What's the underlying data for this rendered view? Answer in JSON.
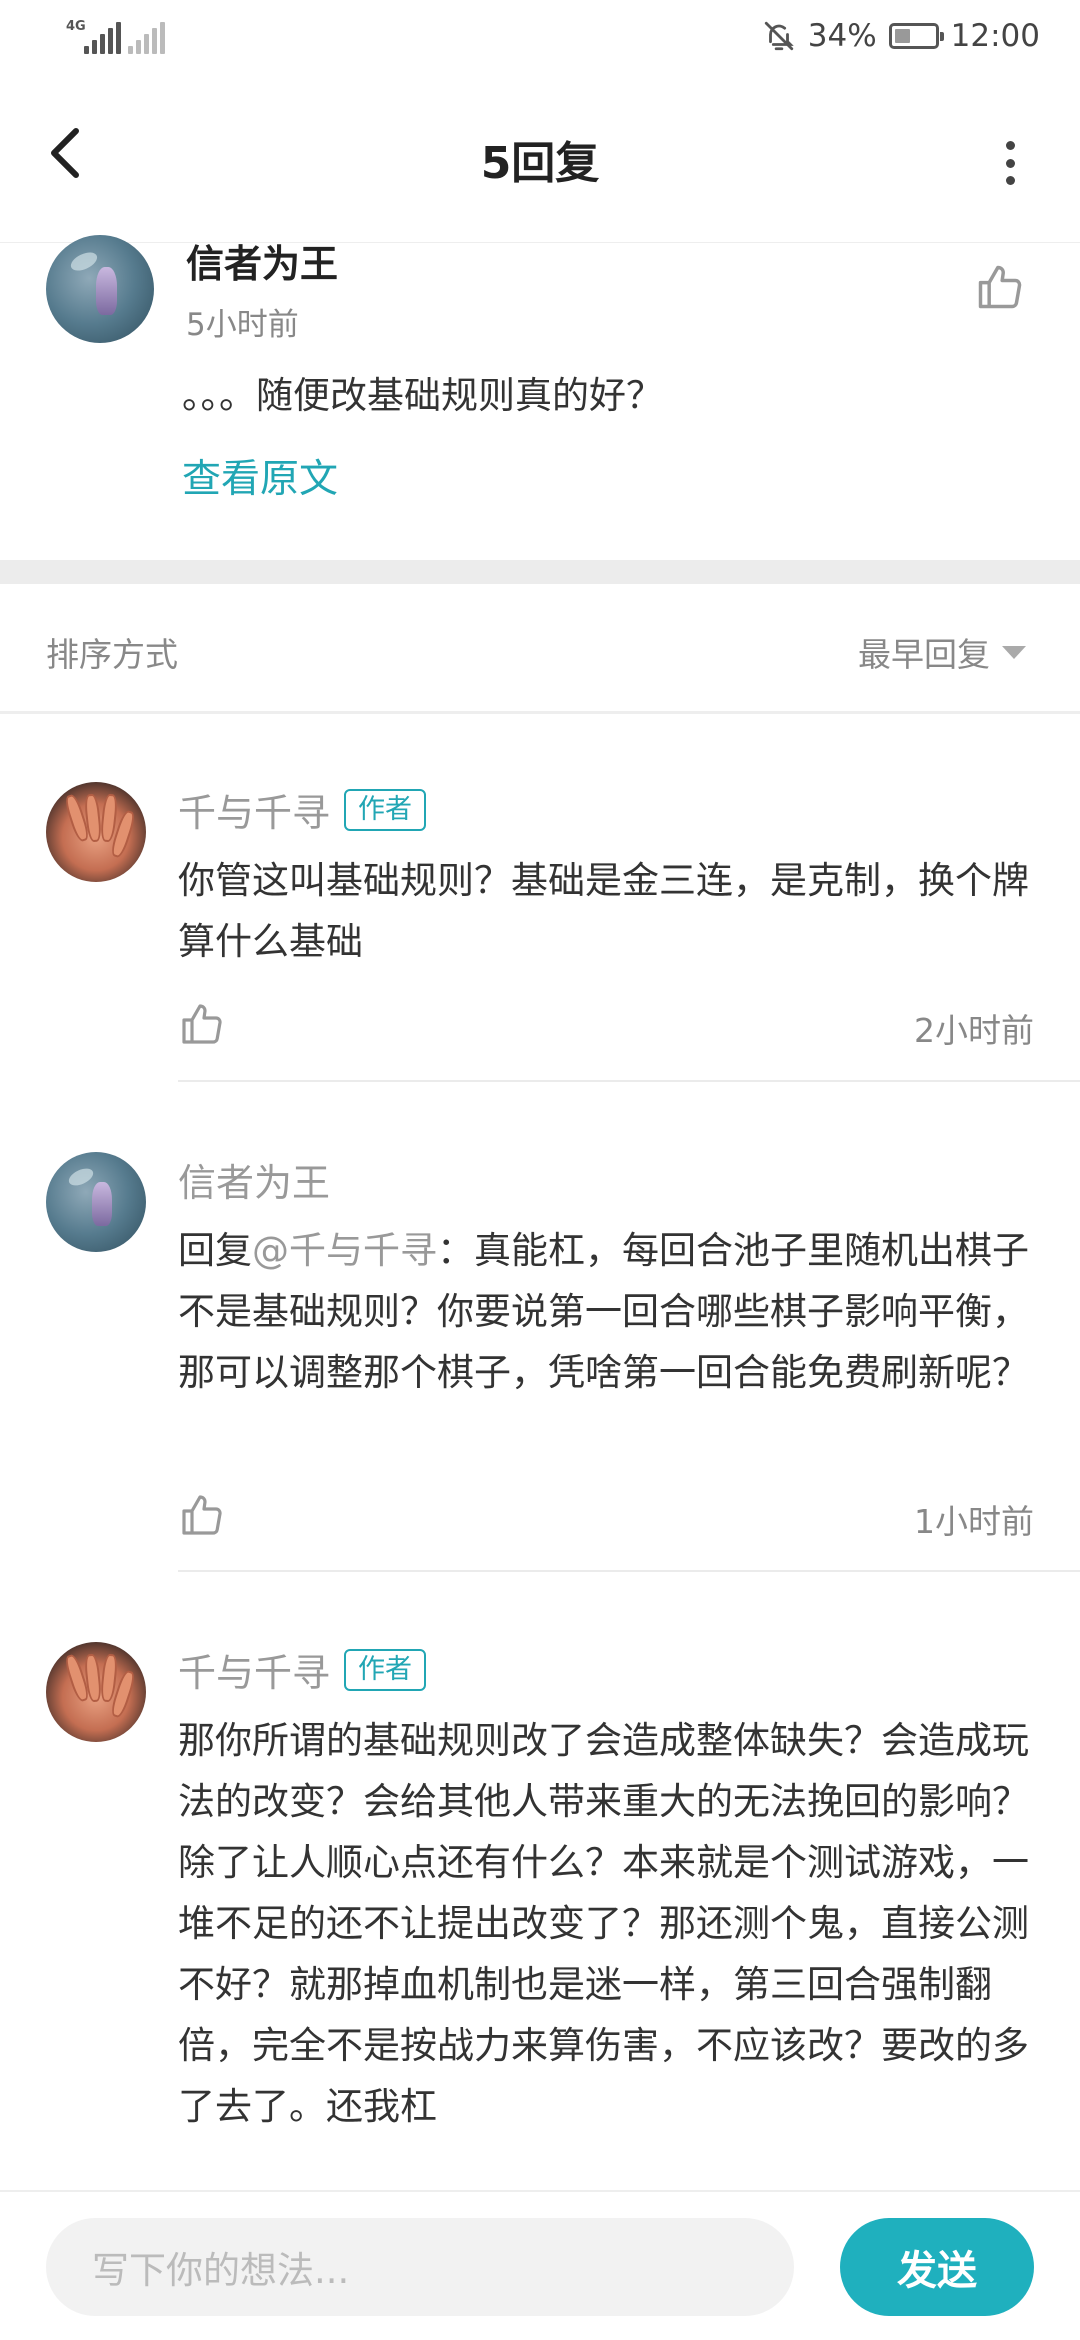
{
  "status_bar": {
    "network_label": "4G",
    "battery_percent": "34%",
    "battery_level": 0.34,
    "time": "12:00",
    "icons": [
      "signal-icon",
      "no-signal-icon",
      "silent-bell-icon",
      "battery-charging-icon"
    ]
  },
  "nav": {
    "title": "5回复",
    "back_icon": "back-arrow-icon",
    "more_icon": "more-vertical-icon"
  },
  "original": {
    "author": "信者为王",
    "time": "5小时前",
    "text": "。。。随便改基础规则真的好？",
    "view_original": "查看原文"
  },
  "sort": {
    "label": "排序方式",
    "value": "最早回复"
  },
  "replies": [
    {
      "author": "千与千寻",
      "badge": "作者",
      "text": "你管这叫基础规则？基础是金三连，是克制，换个牌算什么基础",
      "time": "2小时前"
    },
    {
      "author": "信者为王",
      "reply_prefix": "回复",
      "mention": "@千与千寻",
      "text": "：真能杠，每回合池子里随机出棋子不是基础规则？你要说第一回合哪些棋子影响平衡，那可以调整那个棋子，凭啥第一回合能免费刷新呢？",
      "time": "1小时前"
    },
    {
      "author": "千与千寻",
      "badge": "作者",
      "text": "那你所谓的基础规则改了会造成整体缺失？会造成玩法的改变？会给其他人带来重大的无法挽回的影响？除了让人顺心点还有什么？本来就是个测试游戏，一堆不足的还不让提出改变了？那还测个鬼，直接公测不好？就那掉血机制也是迷一样，第三回合强制翻倍，完全不是按战力来算伤害，不应该改？要改的多了去了。还我杠"
    }
  ],
  "input": {
    "placeholder": "写下你的想法...",
    "send_label": "发送"
  },
  "colors": {
    "accent": "#1fb0be",
    "link": "#21a6b4"
  }
}
